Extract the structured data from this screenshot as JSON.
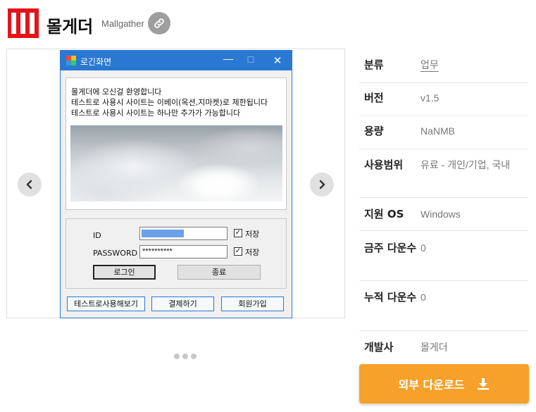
{
  "header": {
    "title": "몰게더",
    "subtitle": "Mallgather",
    "logo_color": "#e4141b"
  },
  "gallery": {
    "screenshot": {
      "window_title": "로긴화면",
      "controls": [
        "—",
        "☐",
        "✕"
      ],
      "welcome_lines": [
        "몰게더에 오신걸 환영합니다",
        "테스트로 사용시 사이트는 이베이(옥션,지마켓)로 제한됩니다",
        "테스트로 사용시 사이트는 하나만 추가가 가능합니다"
      ],
      "id_label": "ID",
      "password_label": "PASSWORD",
      "password_value": "**********",
      "save_label_1": "저장",
      "save_label_2": "저장",
      "login_button": "로그인",
      "exit_button": "종료",
      "test_button": "테스트로사용해보기",
      "pay_button": "결제하기",
      "join_button": "회원가입"
    },
    "page_count": 3,
    "active_page": 1
  },
  "info": {
    "rows": [
      {
        "label": "분류",
        "value": "업무"
      },
      {
        "label": "버전",
        "value": "v1.5"
      },
      {
        "label": "용량",
        "value": "NaNMB"
      },
      {
        "label": "사용범위",
        "value": "유료 - 개인/기업, 국내"
      },
      {
        "label": "지원 OS",
        "value": "Windows"
      },
      {
        "label": "금주 다운수",
        "value": "0"
      },
      {
        "label": "누적 다운수",
        "value": "0"
      },
      {
        "label": "개발사",
        "value": "몰게더"
      }
    ]
  },
  "download": {
    "label": "외부 다운로드",
    "color": "#f7a02a"
  }
}
